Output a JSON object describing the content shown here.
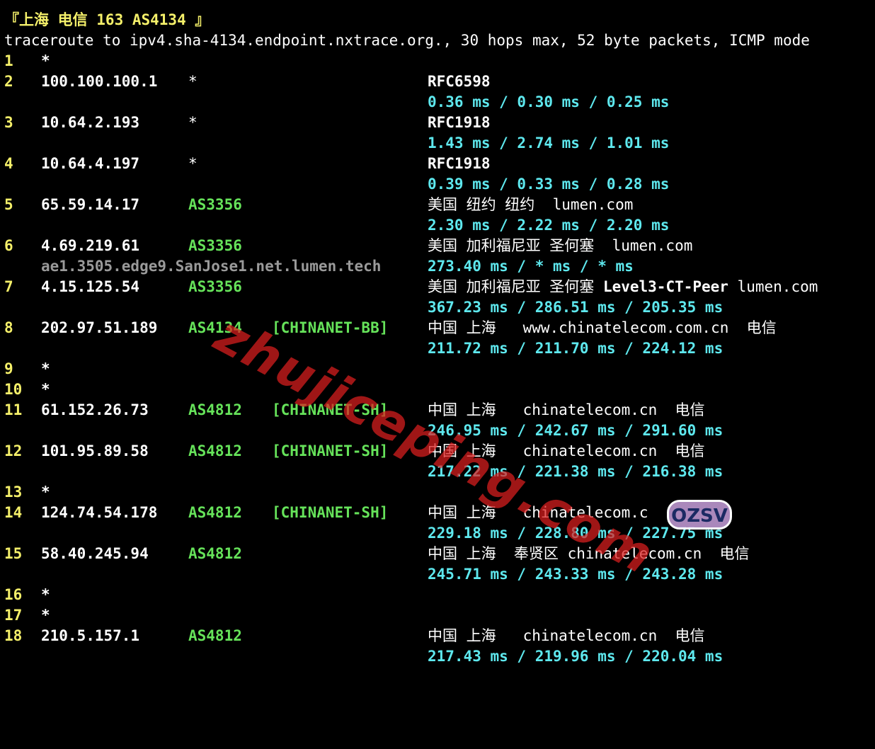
{
  "header": {
    "title": "『上海 电信 163 AS4134 』",
    "command": "traceroute to ipv4.sha-4134.endpoint.nxtrace.org., 30 hops max, 52 byte packets, ICMP mode"
  },
  "hops": [
    {
      "num": "1",
      "ip": "*"
    },
    {
      "num": "2",
      "ip": "100.100.100.1",
      "as": "*",
      "geo": "RFC6598",
      "rtt": "0.36 ms / 0.30 ms / 0.25 ms"
    },
    {
      "num": "3",
      "ip": "10.64.2.193",
      "as": "*",
      "geo": "RFC1918",
      "rtt": "1.43 ms / 2.74 ms / 1.01 ms"
    },
    {
      "num": "4",
      "ip": "10.64.4.197",
      "as": "*",
      "geo": "RFC1918",
      "rtt": "0.39 ms / 0.33 ms / 0.28 ms"
    },
    {
      "num": "5",
      "ip": "65.59.14.17",
      "as": "AS3356",
      "geo": "美国 纽约 纽约  lumen.com",
      "rtt": "2.30 ms / 2.22 ms / 2.20 ms"
    },
    {
      "num": "6",
      "ip": "4.69.219.61",
      "as": "AS3356",
      "geo": "美国 加利福尼亚 圣何塞  lumen.com",
      "hostname": "ae1.3505.edge9.SanJose1.net.lumen.tech",
      "rtt": "273.40 ms / * ms / * ms"
    },
    {
      "num": "7",
      "ip": "4.15.125.54",
      "as": "AS3356",
      "geo_a": "美国 加利福尼亚 圣何塞 ",
      "geo_b": "Level3-CT-Peer",
      "geo_c": " lumen.com",
      "rtt": "367.23 ms / 286.51 ms / 205.35 ms"
    },
    {
      "num": "8",
      "ip": "202.97.51.189",
      "as": "AS4134",
      "net": "[CHINANET-BB]",
      "geo": "中国 上海   www.chinatelecom.com.cn  电信",
      "rtt": "211.72 ms / 211.70 ms / 224.12 ms"
    },
    {
      "num": "9",
      "ip": "*"
    },
    {
      "num": "10",
      "ip": "*"
    },
    {
      "num": "11",
      "ip": "61.152.26.73",
      "as": "AS4812",
      "net": "[CHINANET-SH]",
      "geo": "中国 上海   chinatelecom.cn  电信",
      "rtt": "246.95 ms / 242.67 ms / 291.60 ms"
    },
    {
      "num": "12",
      "ip": "101.95.89.58",
      "as": "AS4812",
      "net": "[CHINANET-SH]",
      "geo": "中国 上海   chinatelecom.cn  电信",
      "rtt": "217.22 ms / 221.38 ms / 216.38 ms"
    },
    {
      "num": "13",
      "ip": "*"
    },
    {
      "num": "14",
      "ip": "124.74.54.178",
      "as": "AS4812",
      "net": "[CHINANET-SH]",
      "geo": "中国 上海   chinatelecom.c",
      "rtt": "229.18 ms / 228.80 ms / 227.75 ms"
    },
    {
      "num": "15",
      "ip": "58.40.245.94",
      "as": "AS4812",
      "geo": "中国 上海  奉贤区 chinatelecom.cn  电信",
      "rtt": "245.71 ms / 243.33 ms / 243.28 ms"
    },
    {
      "num": "16",
      "ip": "*"
    },
    {
      "num": "17",
      "ip": "*"
    },
    {
      "num": "18",
      "ip": "210.5.157.1",
      "as": "AS4812",
      "geo": "中国 上海   chinatelecom.cn  电信",
      "rtt": "217.43 ms / 219.96 ms / 220.04 ms"
    }
  ],
  "watermark": "zhujiceping.com",
  "badge": "OZSV",
  "colors": {
    "hop_number": "#f5f06a",
    "as": "#66e35a",
    "rtt": "#5ee8ee",
    "hostname": "#9a9a9a",
    "background": "#000000"
  }
}
